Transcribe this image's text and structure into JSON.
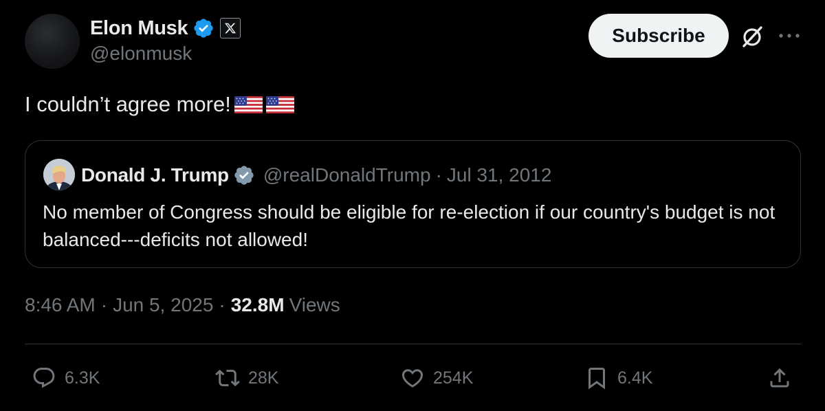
{
  "author": {
    "display_name": "Elon Musk",
    "handle": "@elonmusk",
    "verified_badge": "blue-check-icon",
    "affiliation_badge": "x-logo-icon"
  },
  "header_actions": {
    "subscribe_label": "Subscribe",
    "grok_icon": "grok-icon",
    "more_icon": "more-horizontal-icon"
  },
  "tweet": {
    "text": "I couldn’t agree more!",
    "emojis": [
      "us-flag",
      "us-flag"
    ]
  },
  "quoted_tweet": {
    "display_name": "Donald J. Trump",
    "handle": "@realDonaldTrump",
    "separator": "·",
    "date": "Jul 31, 2012",
    "text": "No member of Congress should be eligible for re-election if our country's budget is not balanced---deficits not allowed!"
  },
  "meta": {
    "time": "8:46 AM",
    "separator": "·",
    "date": "Jun 5, 2025",
    "views_count": "32.8M",
    "views_label": "Views"
  },
  "actions": {
    "replies": "6.3K",
    "reposts": "28K",
    "likes": "254K",
    "bookmarks": "6.4K"
  },
  "colors": {
    "background": "#000000",
    "text_primary": "#e7e9ea",
    "text_secondary": "#71767b",
    "border": "#2f3336",
    "verified_blue": "#1d9bf0",
    "button_bg": "#eff3f4"
  }
}
